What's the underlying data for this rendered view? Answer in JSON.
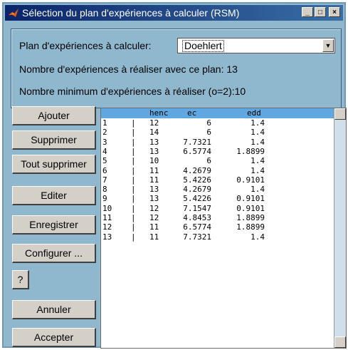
{
  "window": {
    "title": "Sélection du plan d'expériences à calculer (RSM)",
    "controls": [
      "_",
      "□",
      "×"
    ]
  },
  "top": {
    "plan_label": "Plan d'expériences à calculer:",
    "plan_value": "Doehlert",
    "nb_label": "Nombre d'expériences à réaliser avec ce plan: 13",
    "min_label": "Nombre minimum d'expériences à réaliser (o=2):10"
  },
  "buttons": {
    "ajouter": "Ajouter",
    "supprimer": "Supprimer",
    "tout_supprimer": "Tout supprimer",
    "editer": "Editer",
    "enregistrer": "Enregistrer",
    "configurer": "Configurer ...",
    "help": "?",
    "annuler": "Annuler",
    "accepter": "Accepter"
  },
  "table": {
    "columns": [
      "henc",
      "ec",
      "edd"
    ],
    "rows": [
      [
        "1",
        "12",
        "6",
        "1.4"
      ],
      [
        "2",
        "14",
        "6",
        "1.4"
      ],
      [
        "3",
        "13",
        "7.7321",
        "1.4"
      ],
      [
        "4",
        "13",
        "6.5774",
        "1.8899"
      ],
      [
        "5",
        "10",
        "6",
        "1.4"
      ],
      [
        "6",
        "11",
        "4.2679",
        "1.4"
      ],
      [
        "7",
        "11",
        "5.4226",
        "0.9101"
      ],
      [
        "8",
        "13",
        "4.2679",
        "1.4"
      ],
      [
        "9",
        "13",
        "5.4226",
        "0.9101"
      ],
      [
        "10",
        "12",
        "7.1547",
        "0.9101"
      ],
      [
        "11",
        "12",
        "4.8453",
        "1.8899"
      ],
      [
        "12",
        "11",
        "6.5774",
        "1.8899"
      ],
      [
        "13",
        "11",
        "7.7321",
        "1.4"
      ]
    ]
  },
  "colors": {
    "window_bg": "#8fb8cf",
    "title_bg": "#0a246a",
    "header_bg": "#5fa7e0"
  }
}
